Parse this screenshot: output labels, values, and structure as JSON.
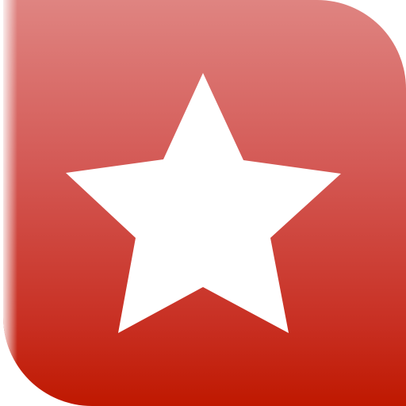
{
  "icon": {
    "name": "star-icon",
    "shape": "five-pointed-star",
    "style": "rounded-tile"
  },
  "colors": {
    "tile_top": "#df8481",
    "tile_middle": "#d45a56",
    "tile_bottom": "#bf1800",
    "star": "#ffffff",
    "background": "#ffffff"
  }
}
